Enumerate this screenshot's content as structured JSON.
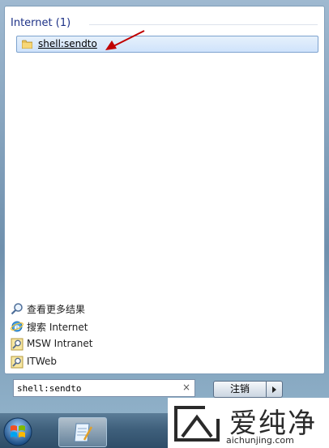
{
  "results": {
    "group_header": "Internet (1)",
    "items": [
      {
        "label": "shell:sendto",
        "icon": "folder-icon"
      }
    ]
  },
  "links": [
    {
      "label": "查看更多结果",
      "icon": "search-icon"
    },
    {
      "label": "搜索 Internet",
      "icon": "internet-explorer-icon"
    },
    {
      "label": "MSW Intranet",
      "icon": "search-connector-icon"
    },
    {
      "label": "ITWeb",
      "icon": "search-connector-icon"
    }
  ],
  "search": {
    "value": "shell:sendto",
    "clear_symbol": "×"
  },
  "power": {
    "logoff_label": "注销"
  },
  "taskbar": {
    "start_icon": "windows-orb-icon",
    "pinned_app_icon": "notepad-icon"
  },
  "watermark": {
    "chinese": "爱纯净",
    "english": "aichunjing.com"
  },
  "colors": {
    "header_text": "#1e3287",
    "selection": "#cfe3fb",
    "arrow": "#c00000"
  }
}
